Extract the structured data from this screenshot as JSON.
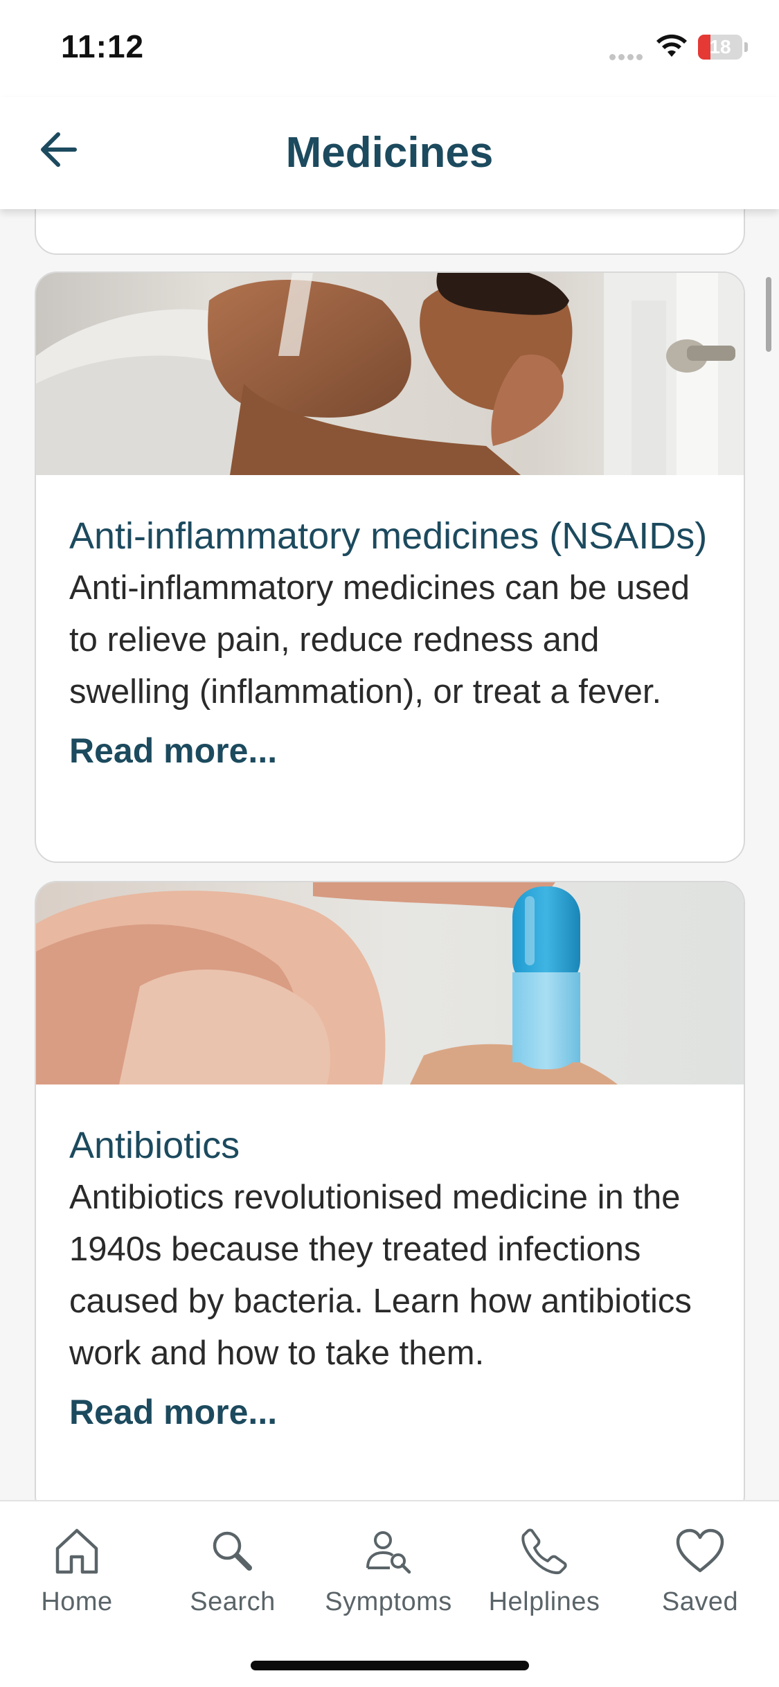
{
  "status_bar": {
    "time": "11:12",
    "battery_level": "18",
    "battery_color": "#e53935"
  },
  "header": {
    "title": "Medicines",
    "back_icon": "arrow-left-icon"
  },
  "cards": [
    {
      "title": "Anti-inflammatory medicines (NSAIDs)",
      "description": "Anti-inflammatory medicines can be used to relieve pain, reduce redness and swelling (inflammation), or treat a fever.",
      "read_more": "Read more..."
    },
    {
      "title": "Antibiotics",
      "description": "Antibiotics revolutionised medicine in the 1940s because they treated infections caused by bacteria. Learn how antibiotics work and how to take them.",
      "read_more": "Read more..."
    }
  ],
  "tab_bar": {
    "tabs": [
      {
        "label": "Home",
        "icon": "home-icon"
      },
      {
        "label": "Search",
        "icon": "search-icon"
      },
      {
        "label": "Symptoms",
        "icon": "symptoms-icon"
      },
      {
        "label": "Helplines",
        "icon": "phone-icon"
      },
      {
        "label": "Saved",
        "icon": "heart-icon"
      }
    ]
  },
  "colors": {
    "brand": "#1c4a5e",
    "tab_text": "#5a6468"
  }
}
